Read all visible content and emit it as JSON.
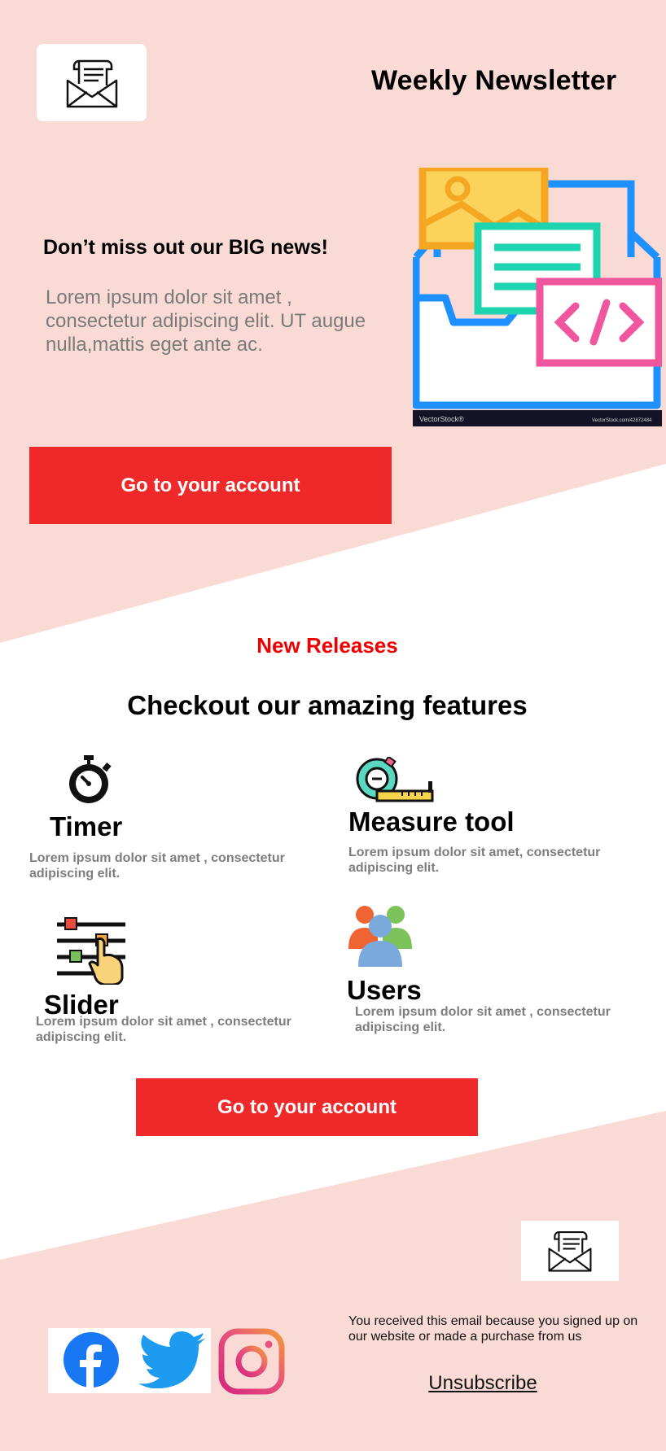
{
  "header": {
    "title": "Weekly Newsletter",
    "logo_icon": "newsletter-envelope-icon"
  },
  "hero": {
    "heading": "Don’t miss out our BIG news!",
    "body": "Lorem ipsum dolor sit amet , consectetur adipiscing elit. UT augue nulla,mattis eget ante ac.",
    "illustration_icon": "documents-folder-illustration",
    "watermark": "VectorStock®",
    "watermark_id": "VectorStock.com/42872484",
    "cta_label": "Go to your account"
  },
  "features_section": {
    "kicker": "New Releases",
    "title": "Checkout our amazing features",
    "items": [
      {
        "icon": "timer-icon",
        "title": "Timer",
        "desc": "Lorem ipsum  dolor sit amet , consectetur adipiscing elit."
      },
      {
        "icon": "measure-tape-icon",
        "title": "Measure tool",
        "desc": "Lorem ipsum dolor sit amet, consectetur adipiscing elit."
      },
      {
        "icon": "slider-icon",
        "title": "Slider",
        "desc": "Lorem ipsum  dolor sit amet , consectetur adipiscing elit."
      },
      {
        "icon": "users-icon",
        "title": "Users",
        "desc": "Lorem ipsum dolor sit amet , consectetur adipiscing elit."
      }
    ],
    "cta_label": "Go to your account"
  },
  "footer": {
    "badge_icon": "newsletter-envelope-icon",
    "social": [
      {
        "icon": "facebook-icon"
      },
      {
        "icon": "twitter-icon"
      },
      {
        "icon": "instagram-icon"
      }
    ],
    "note": "You received this email because you signed up on our website or made a purchase from us",
    "unsubscribe": "Unsubscribe"
  },
  "colors": {
    "background_pink": "#fadad4",
    "cta_red": "#ef2929",
    "kicker_red": "#ee0000",
    "facebook_blue": "#1877f2",
    "twitter_blue": "#1d9bf0"
  }
}
